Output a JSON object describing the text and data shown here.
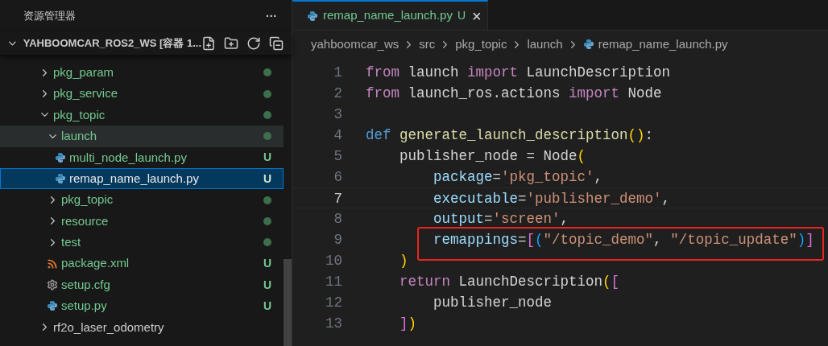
{
  "sidebar": {
    "title": "资源管理器",
    "more": "···",
    "root": {
      "label": "YAHBOOMCAR_ROS2_WS [容器 1...",
      "expanded": true
    },
    "items": [
      {
        "kind": "folder",
        "label": "pkg_param",
        "expanded": false,
        "selected": false,
        "hovered": false,
        "color": "#73c991",
        "modified": true
      },
      {
        "kind": "folder",
        "label": "pkg_service",
        "expanded": false,
        "selected": false,
        "hovered": false,
        "color": "#73c991",
        "modified": true
      },
      {
        "kind": "folder",
        "label": "pkg_topic",
        "expanded": true,
        "selected": false,
        "hovered": false,
        "color": "#73c991",
        "modified": true,
        "children": [
          {
            "kind": "folder",
            "label": "launch",
            "expanded": true,
            "selected": false,
            "hovered": true,
            "color": "#73c991",
            "modified": true,
            "children": [
              {
                "kind": "python",
                "label": "multi_node_launch.py",
                "selected": false,
                "hovered": false,
                "color": "#73c991",
                "badge": "U"
              },
              {
                "kind": "python",
                "label": "remap_name_launch.py",
                "selected": true,
                "hovered": false,
                "badge": "U"
              }
            ]
          },
          {
            "kind": "folder",
            "label": "pkg_topic",
            "expanded": false,
            "selected": false,
            "hovered": false,
            "color": "#73c991",
            "modified": true
          },
          {
            "kind": "folder",
            "label": "resource",
            "expanded": false,
            "selected": false,
            "hovered": false,
            "color": "#73c991",
            "modified": true
          },
          {
            "kind": "folder",
            "label": "test",
            "expanded": false,
            "selected": false,
            "hovered": false,
            "color": "#73c991",
            "modified": true
          },
          {
            "kind": "xml",
            "label": "package.xml",
            "selected": false,
            "hovered": false,
            "color": "#73c991",
            "badge": "U"
          },
          {
            "kind": "config",
            "label": "setup.cfg",
            "selected": false,
            "hovered": false,
            "color": "#73c991",
            "badge": "U"
          },
          {
            "kind": "python",
            "label": "setup.py",
            "selected": false,
            "hovered": false,
            "color": "#73c991",
            "badge": "U"
          }
        ]
      },
      {
        "kind": "folder",
        "label": "rf2o_laser_odometry",
        "expanded": false,
        "selected": false,
        "hovered": false,
        "color": "#cccccc",
        "modified": false
      }
    ]
  },
  "tab": {
    "label": "remap_name_launch.py",
    "badge": "U",
    "close": "×",
    "selected": true
  },
  "breadcrumbs": [
    "yahboomcar_ws",
    "src",
    "pkg_topic",
    "launch",
    "remap_name_launch.py"
  ],
  "code": [
    {
      "number": "1",
      "current": false,
      "boxed": false,
      "tokens": [
        {
          "kind": "keyword",
          "text": "from"
        },
        {
          "kind": "plain",
          "text": " launch "
        },
        {
          "kind": "keyword",
          "text": "import"
        },
        {
          "kind": "plain",
          "text": " LaunchDescription"
        }
      ]
    },
    {
      "number": "2",
      "current": false,
      "boxed": false,
      "tokens": [
        {
          "kind": "keyword",
          "text": "from"
        },
        {
          "kind": "plain",
          "text": " launch_ros.actions "
        },
        {
          "kind": "keyword",
          "text": "import"
        },
        {
          "kind": "plain",
          "text": " Node"
        }
      ]
    },
    {
      "number": "3",
      "current": false,
      "boxed": false
    },
    {
      "number": "4",
      "current": false,
      "boxed": false,
      "tokens": [
        {
          "kind": "def",
          "text": "def"
        },
        {
          "kind": "func",
          "text": " generate_launch_description"
        },
        {
          "kind": "bracket1",
          "text": "()"
        },
        {
          "kind": "plain",
          "text": ":"
        }
      ]
    },
    {
      "number": "5",
      "current": false,
      "boxed": false,
      "tokens": [
        {
          "kind": "plain",
          "text": "    publisher_node = Node"
        },
        {
          "kind": "bracket1",
          "text": "("
        }
      ]
    },
    {
      "number": "6",
      "current": false,
      "boxed": false,
      "tokens": [
        {
          "kind": "param",
          "text": "        package"
        },
        {
          "kind": "plain",
          "text": "="
        },
        {
          "kind": "string",
          "text": "'pkg_topic'"
        },
        {
          "kind": "plain",
          "text": ","
        }
      ]
    },
    {
      "number": "7",
      "current": true,
      "boxed": false,
      "tokens": [
        {
          "kind": "param",
          "text": "        executable"
        },
        {
          "kind": "plain",
          "text": "="
        },
        {
          "kind": "string",
          "text": "'publisher_demo'"
        },
        {
          "kind": "plain",
          "text": ","
        }
      ]
    },
    {
      "number": "8",
      "current": false,
      "boxed": false,
      "tokens": [
        {
          "kind": "param",
          "text": "        output"
        },
        {
          "kind": "plain",
          "text": "="
        },
        {
          "kind": "string",
          "text": "'screen'"
        },
        {
          "kind": "plain",
          "text": ","
        }
      ]
    },
    {
      "number": "9",
      "current": false,
      "boxed": true,
      "tokens": [
        {
          "kind": "param",
          "text": "        remappings"
        },
        {
          "kind": "plain",
          "text": "="
        },
        {
          "kind": "bracket2",
          "text": "["
        },
        {
          "kind": "bracket3",
          "text": "("
        },
        {
          "kind": "string",
          "text": "\"/topic_demo\""
        },
        {
          "kind": "plain",
          "text": ", "
        },
        {
          "kind": "string",
          "text": "\"/topic_update\""
        },
        {
          "kind": "bracket3",
          "text": ")"
        },
        {
          "kind": "bracket2",
          "text": "]"
        }
      ]
    },
    {
      "number": "10",
      "current": false,
      "boxed": false,
      "tokens": [
        {
          "kind": "bracket1",
          "text": "    )"
        }
      ]
    },
    {
      "number": "11",
      "current": false,
      "boxed": false,
      "tokens": [
        {
          "kind": "keyword",
          "text": "    return"
        },
        {
          "kind": "plain",
          "text": " LaunchDescription"
        },
        {
          "kind": "bracket1",
          "text": "("
        },
        {
          "kind": "bracket2",
          "text": "["
        }
      ]
    },
    {
      "number": "12",
      "current": false,
      "boxed": false,
      "tokens": [
        {
          "kind": "plain",
          "text": "        publisher_node"
        }
      ]
    },
    {
      "number": "13",
      "current": false,
      "boxed": false,
      "tokens": [
        {
          "kind": "bracket2",
          "text": "    ]"
        },
        {
          "kind": "bracket1",
          "text": ")"
        }
      ]
    }
  ]
}
